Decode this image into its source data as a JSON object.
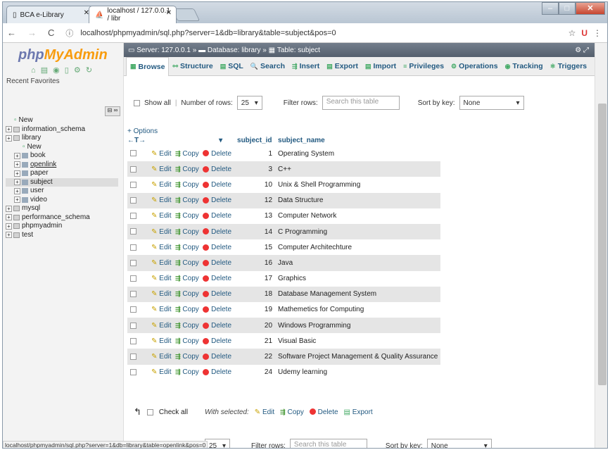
{
  "browser": {
    "tabs": [
      {
        "label": "BCA e-Library"
      },
      {
        "label": "localhost / 127.0.0.1 / libr"
      }
    ],
    "url": "localhost/phpmyadmin/sql.php?server=1&db=library&table=subject&pos=0",
    "status_url": "localhost/phpmyadmin/sql.php?server=1&db=library&table=openlink&pos=0"
  },
  "sidebar": {
    "logo_a": "php",
    "logo_b": "MyAdmin",
    "recent": "Recent",
    "favorites": "Favorites",
    "tree": [
      {
        "label": "New",
        "level": 1,
        "type": "new"
      },
      {
        "label": "information_schema",
        "level": 0,
        "type": "db"
      },
      {
        "label": "library",
        "level": 0,
        "type": "db"
      },
      {
        "label": "New",
        "level": 2,
        "type": "new"
      },
      {
        "label": "book",
        "level": 1,
        "type": "table"
      },
      {
        "label": "openlink",
        "level": 1,
        "type": "table"
      },
      {
        "label": "paper",
        "level": 1,
        "type": "table"
      },
      {
        "label": "subject",
        "level": 1,
        "type": "table"
      },
      {
        "label": "user",
        "level": 1,
        "type": "table"
      },
      {
        "label": "video",
        "level": 1,
        "type": "table"
      },
      {
        "label": "mysql",
        "level": 0,
        "type": "db"
      },
      {
        "label": "performance_schema",
        "level": 0,
        "type": "db"
      },
      {
        "label": "phpmyadmin",
        "level": 0,
        "type": "db"
      },
      {
        "label": "test",
        "level": 0,
        "type": "db"
      }
    ]
  },
  "breadcrumb": {
    "server": "Server: 127.0.0.1",
    "database": "Database: library",
    "table": "Table: subject"
  },
  "tabs": [
    "Browse",
    "Structure",
    "SQL",
    "Search",
    "Insert",
    "Export",
    "Import",
    "Privileges",
    "Operations",
    "Tracking",
    "Triggers"
  ],
  "filters": {
    "show_all": "Show all",
    "num_rows_label": "Number of rows:",
    "num_rows": "25",
    "filter_label": "Filter rows:",
    "filter_placeholder": "Search this table",
    "sort_label": "Sort by key:",
    "sort_value": "None"
  },
  "options": "+ Options",
  "table": {
    "columns": [
      "subject_id",
      "subject_name"
    ],
    "actions": {
      "edit": "Edit",
      "copy": "Copy",
      "delete": "Delete"
    },
    "rows": [
      {
        "id": "1",
        "name": "Operating System"
      },
      {
        "id": "3",
        "name": "C++"
      },
      {
        "id": "10",
        "name": "Unix & Shell Programming"
      },
      {
        "id": "12",
        "name": "Data Structure"
      },
      {
        "id": "13",
        "name": "Computer Network"
      },
      {
        "id": "14",
        "name": "C Programming"
      },
      {
        "id": "15",
        "name": "Computer Architechture"
      },
      {
        "id": "16",
        "name": "Java"
      },
      {
        "id": "17",
        "name": "Graphics"
      },
      {
        "id": "18",
        "name": "Database Management System"
      },
      {
        "id": "19",
        "name": "Mathemetics for Computing"
      },
      {
        "id": "20",
        "name": "Windows Programming"
      },
      {
        "id": "21",
        "name": "Visual Basic"
      },
      {
        "id": "22",
        "name": "Software Project Management & Quality Assurance"
      },
      {
        "id": "24",
        "name": "Udemy learning"
      }
    ]
  },
  "bulk": {
    "check_all": "Check all",
    "with_selected": "With selected:",
    "edit": "Edit",
    "copy": "Copy",
    "delete": "Delete",
    "export": "Export"
  }
}
